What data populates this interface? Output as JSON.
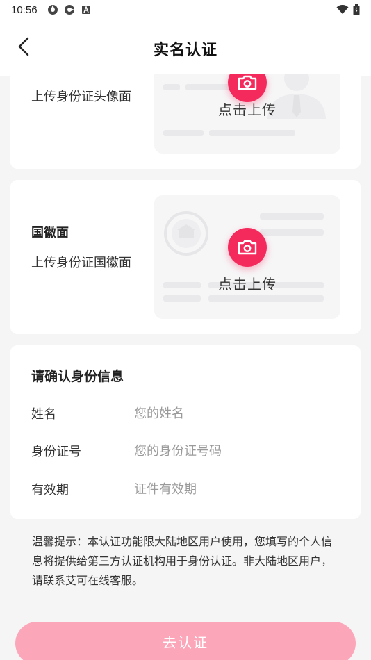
{
  "status_bar": {
    "time": "10:56"
  },
  "header": {
    "title": "实名认证"
  },
  "card_portrait": {
    "description": "上传身份证头像面",
    "upload_label": "点击上传"
  },
  "card_emblem": {
    "title": "国徽面",
    "description": "上传身份证国徽面",
    "upload_label": "点击上传"
  },
  "confirm_form": {
    "title": "请确认身份信息",
    "fields": [
      {
        "label": "姓名",
        "placeholder": "您的姓名"
      },
      {
        "label": "身份证号",
        "placeholder": "您的身份证号码"
      },
      {
        "label": "有效期",
        "placeholder": "证件有效期"
      }
    ]
  },
  "notice": "温馨提示：本认证功能限大陆地区用户使用，您填写的个人信息将提供给第三方认证机构用于身份认证。非大陆地区用户，请联系艾可在线客服。",
  "submit": {
    "label": "去认证"
  },
  "colors": {
    "accent": "#f52a5c",
    "submit_disabled": "#fca6b9",
    "background": "#f5f5f5"
  },
  "icons": [
    "back-icon",
    "camera-icon",
    "wifi-icon",
    "battery-icon"
  ]
}
